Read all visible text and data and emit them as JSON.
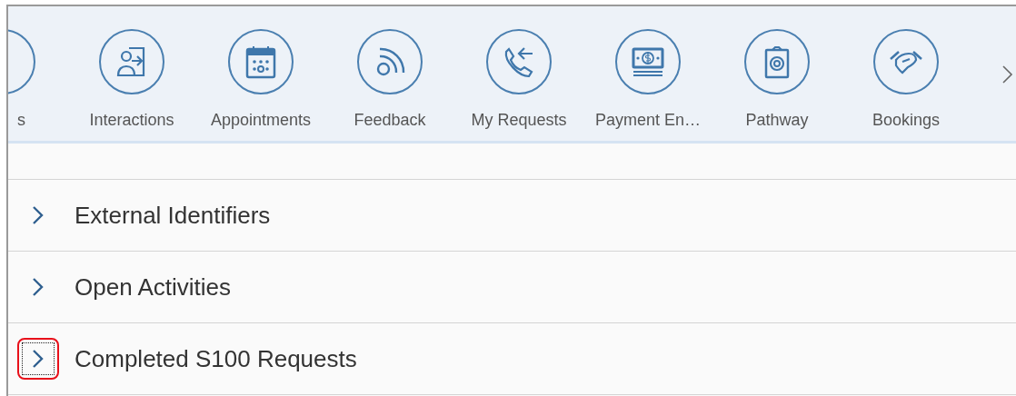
{
  "launchpad": {
    "tiles": [
      {
        "label": "s"
      },
      {
        "label": "Interactions"
      },
      {
        "label": "Appointments"
      },
      {
        "label": "Feedback"
      },
      {
        "label": "My Requests"
      },
      {
        "label": "Payment En…"
      },
      {
        "label": "Pathway"
      },
      {
        "label": "Bookings"
      }
    ]
  },
  "sections": [
    {
      "title": "External Identifiers",
      "expanded": false,
      "focused": false,
      "highlighted": false
    },
    {
      "title": "Open Activities",
      "expanded": false,
      "focused": false,
      "highlighted": false
    },
    {
      "title": "Completed S100 Requests",
      "expanded": false,
      "focused": true,
      "highlighted": true
    }
  ]
}
